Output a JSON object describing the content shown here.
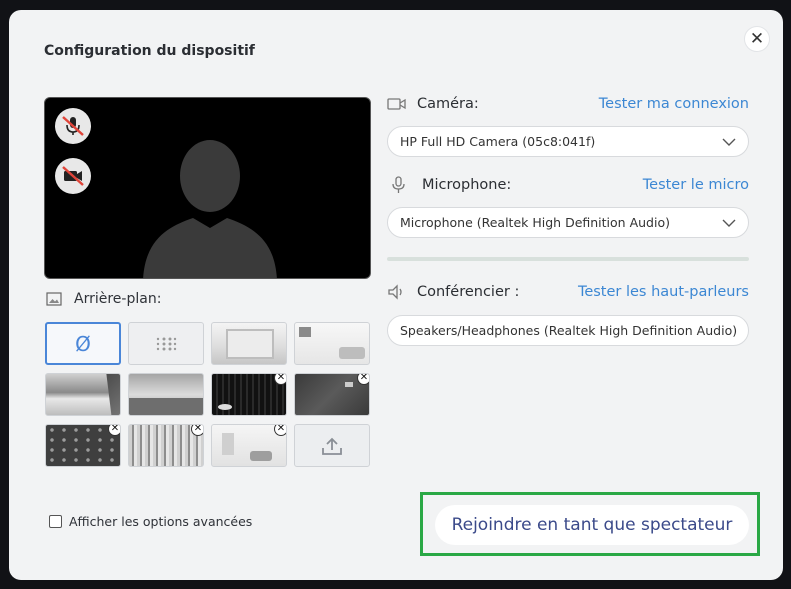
{
  "dialog": {
    "title": "Configuration du dispositif"
  },
  "camera": {
    "label": "Caméra:",
    "test_link": "Tester ma connexion",
    "selected": "HP Full HD Camera (05c8:041f)"
  },
  "microphone": {
    "label": "Microphone:",
    "test_link": "Tester le micro",
    "selected": "Microphone (Realtek High Definition Audio)",
    "level_percent": 0
  },
  "speaker": {
    "label": "Conférencier :",
    "test_link": "Tester les haut-parleurs",
    "selected": "Speakers/Headphones (Realtek High Definition Audio)"
  },
  "background": {
    "label": "Arrière-plan:",
    "none_symbol": "Ø",
    "upload_icon": "upload-icon",
    "remove_symbol": "✕"
  },
  "advanced": {
    "label": "Afficher les options avancées",
    "checked": false
  },
  "join": {
    "label": "Rejoindre en tant que spectateur"
  },
  "colors": {
    "link": "#3c87d3",
    "selected_border": "#4a86d8",
    "highlight_frame": "#2aa845"
  }
}
